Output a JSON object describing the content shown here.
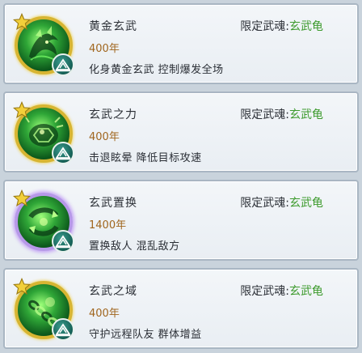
{
  "colors": {
    "years": "#a0661e",
    "soul_value": "#3c9a2c",
    "ring_gold": "#d7b532",
    "ring_purple": "#b698e8"
  },
  "skills": [
    {
      "name": "黄金玄武",
      "years": "400年",
      "soul_label": "限定武魂:",
      "soul_value": "玄武龟",
      "desc": "化身黄金玄武  控制爆发全场",
      "ring": "gold",
      "icon": "dragon-turtle-icon"
    },
    {
      "name": "玄武之力",
      "years": "400年",
      "soul_label": "限定武魂:",
      "soul_value": "玄武龟",
      "desc": "击退眩晕  降低目标攻速",
      "ring": "gold",
      "icon": "shell-burst-icon"
    },
    {
      "name": "玄武置换",
      "years": "1400年",
      "soul_label": "限定武魂:",
      "soul_value": "玄武龟",
      "desc": "置换敌人  混乱敌方",
      "ring": "purple",
      "icon": "swap-icon"
    },
    {
      "name": "玄武之域",
      "years": "400年",
      "soul_label": "限定武魂:",
      "soul_value": "玄武龟",
      "desc": "守护远程队友  群体增益",
      "ring": "gold",
      "icon": "chain-shield-icon"
    }
  ]
}
